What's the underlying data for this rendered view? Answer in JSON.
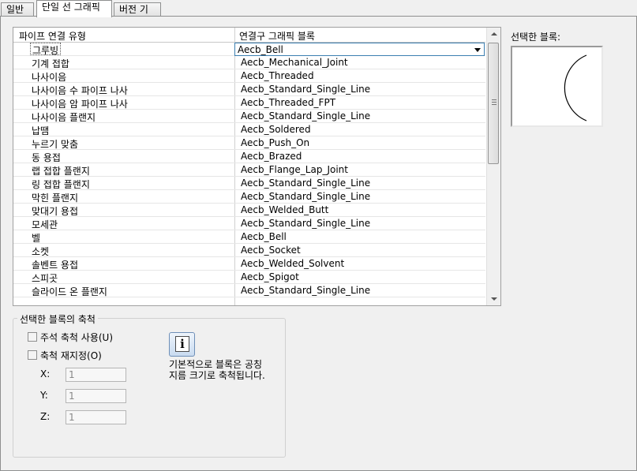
{
  "tabs": [
    {
      "label": "일반"
    },
    {
      "label": "단일 선 그래픽"
    },
    {
      "label": "버전 기록"
    }
  ],
  "grid": {
    "col1_header": "파이프 연결 유형",
    "col2_header": "연결구 그래픽 블록",
    "selected_value": "Aecb_Bell",
    "rows": [
      {
        "type": "그루빙",
        "block": "Aecb_Bell"
      },
      {
        "type": "기계 접합",
        "block": "Aecb_Mechanical_Joint"
      },
      {
        "type": "나사이음",
        "block": "Aecb_Threaded"
      },
      {
        "type": "나사이음 수 파이프 나사",
        "block": "Aecb_Standard_Single_Line"
      },
      {
        "type": "나사이음 암 파이프 나사",
        "block": "Aecb_Threaded_FPT"
      },
      {
        "type": "나사이음 플랜지",
        "block": "Aecb_Standard_Single_Line"
      },
      {
        "type": "납땜",
        "block": "Aecb_Soldered"
      },
      {
        "type": "누르기 맞춤",
        "block": "Aecb_Push_On"
      },
      {
        "type": "동 용접",
        "block": "Aecb_Brazed"
      },
      {
        "type": "랩 접합 플랜지",
        "block": "Aecb_Flange_Lap_Joint"
      },
      {
        "type": "링 접합 플랜지",
        "block": "Aecb_Standard_Single_Line"
      },
      {
        "type": "막힌 플랜지",
        "block": "Aecb_Standard_Single_Line"
      },
      {
        "type": "맞대기 용접",
        "block": "Aecb_Welded_Butt"
      },
      {
        "type": "모세관",
        "block": "Aecb_Standard_Single_Line"
      },
      {
        "type": "벨",
        "block": "Aecb_Bell"
      },
      {
        "type": "소켓",
        "block": "Aecb_Socket"
      },
      {
        "type": "솔벤트 용접",
        "block": "Aecb_Welded_Solvent"
      },
      {
        "type": "스피곳",
        "block": "Aecb_Spigot"
      },
      {
        "type": "슬라이드 온 플랜지",
        "block": "Aecb_Standard_Single_Line"
      }
    ]
  },
  "preview": {
    "label": "선택한 블록:"
  },
  "scale_group": {
    "title": "선택한 블록의 축척",
    "use_annotation_scale": "주석 축척 사용(U)",
    "reset_scale": "축척 재지정(O)",
    "x_label": "X:",
    "y_label": "Y:",
    "z_label": "Z:",
    "x_value": "1",
    "y_value": "1",
    "z_value": "1",
    "info_line1": "기본적으로 블록은 공칭",
    "info_line2": "지름 크기로 축척됩니다."
  },
  "icons": {
    "info": "info-icon",
    "dropdown": "chevron-down-icon"
  }
}
